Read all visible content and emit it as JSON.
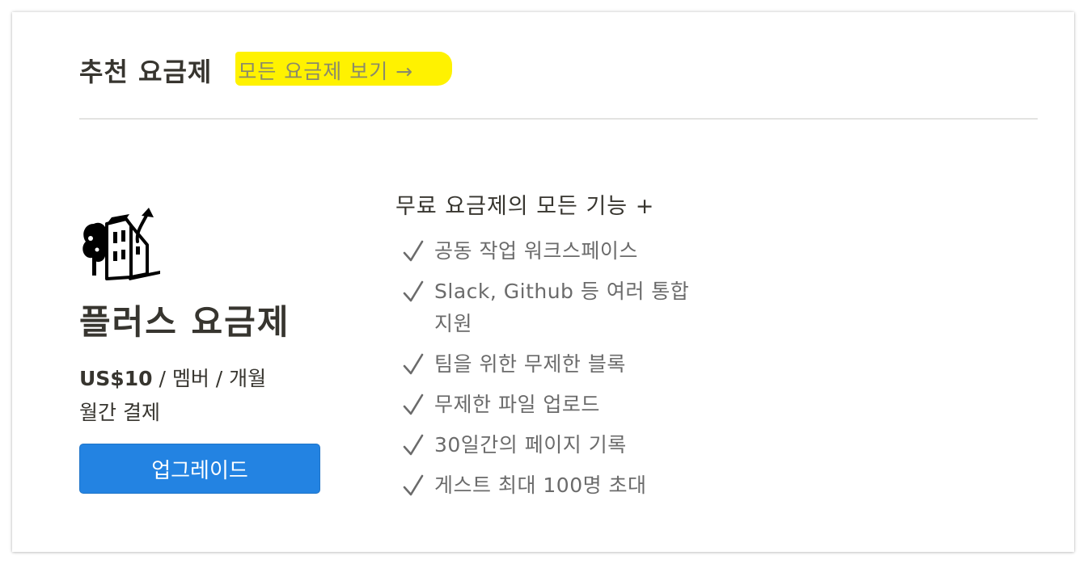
{
  "header": {
    "title": "추천 요금제",
    "all_plans_link": "모든 요금제 보기 →"
  },
  "plan": {
    "icon": "building-illustration-icon",
    "name": "플러스 요금제",
    "price_amount": "US$10",
    "price_unit": " / 멤버 / 개월",
    "billing": "월간 결제",
    "upgrade_label": "업그레이드"
  },
  "features": {
    "title": "무료 요금제의 모든 기능 +",
    "items": [
      "공동 작업 워크스페이스",
      "Slack, Github 등 여러 통합 지원",
      "팀을 위한 무제한 블록",
      "무제한 파일 업로드",
      "30일간의 페이지 기록",
      "게스트 최대 100명 초대"
    ]
  },
  "colors": {
    "accent": "#2383e2",
    "highlight": "#fff200",
    "text": "#37352f",
    "muted": "#6b6b6b"
  }
}
